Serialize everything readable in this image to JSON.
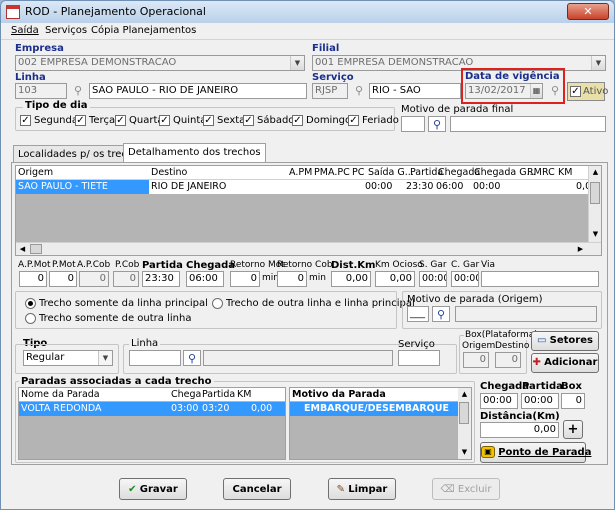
{
  "window": {
    "title": "ROD - Planejamento Operacional",
    "app_icon": "calendar-icon"
  },
  "menu": [
    "Saída",
    "Serviços",
    "Cópia Planejamentos"
  ],
  "empresa": {
    "label": "Empresa",
    "value": "002 EMPRESA DEMONSTRACAO"
  },
  "filial": {
    "label": "Filial",
    "value": "001 EMPRESA DEMONSTRACAO"
  },
  "linha": {
    "label": "Linha",
    "code": "103",
    "name": "SAO PAULO - RIO DE JANEIRO"
  },
  "servico": {
    "label": "Serviço",
    "code": "RJSP",
    "name": "RIO - SAO"
  },
  "vigencia": {
    "label": "Data de vigência",
    "value": "13/02/2017",
    "highlight": "#e0201c"
  },
  "ativo": {
    "label": "Ativo",
    "checked": true
  },
  "tipo_dia": {
    "label": "Tipo de dia",
    "days": [
      "Segunda",
      "Terça",
      "Quarta",
      "Quinta",
      "Sexta",
      "Sábado",
      "Domingo",
      "Feriado"
    ]
  },
  "motivo_final": {
    "label": "Motivo de parada final"
  },
  "tabs": [
    "Localidades p/ os trechos",
    "Detalhamento dos trechos"
  ],
  "grid": {
    "headers": [
      "Origem",
      "Destino",
      "A.PM",
      "PM",
      "A.PC",
      "PC",
      "Saída G...",
      "Partida",
      "Chegada",
      "Chegada G...",
      "RM",
      "RC",
      "KM"
    ],
    "rows": [
      {
        "origem": "SAO PAULO - TIETE",
        "destino": "RIO DE JANEIRO",
        "saida": "00:00",
        "partida": "23:30",
        "chegada": "06:00",
        "chegada_g": "00:00",
        "km": "0,0"
      }
    ]
  },
  "detail_labels": {
    "apmot": "A.P.Mot",
    "pmot": "P.Mot",
    "apcob": "A.P.Cob",
    "pcob": "P.Cob",
    "partida": "Partida",
    "chegada": "Chegada",
    "retmot": "Retorno Mot",
    "retcob": "Retorno Cob",
    "distkm": "Dist.Km",
    "kmocioso": "Km Ocioso",
    "sgar": "S. Gar",
    "cgar": "C. Gar",
    "via": "Via",
    "min": "min"
  },
  "detail_values": {
    "apmot": "0",
    "pmot": "0",
    "apcob": "0",
    "pcob": "0",
    "partida": "23:30",
    "chegada": "06:00",
    "retmot": "0",
    "retcob": "0",
    "distkm": "0,00",
    "kmocioso": "0,00",
    "sgar": "00:00",
    "cgar": "00:00",
    "via": ""
  },
  "radios": [
    "Trecho somente da linha principal",
    "Trecho somente de outra linha",
    "Trecho de outra linha e linha principal"
  ],
  "motivo_origem": {
    "label": "Motivo de parada (Origem)",
    "code": "___"
  },
  "tipo": {
    "label": "Tipo",
    "value": "Regular"
  },
  "linha2": {
    "label": "Linha"
  },
  "servico2": {
    "label": "Serviço"
  },
  "box": {
    "label": "Box(Plataforma)",
    "origem_label": "Origem",
    "destino_label": "Destino",
    "origem": "0",
    "destino": "0"
  },
  "setores_button": "Setores",
  "adicionar_button": "Adicionar",
  "paradas": {
    "title": "Paradas associadas a cada trecho",
    "headers": [
      "Nome da Parada",
      "Chega",
      "Partida",
      "KM"
    ],
    "rows": [
      {
        "nome": "VOLTA REDONDA",
        "chega": "03:00",
        "partida": "03:20",
        "km": "0,00"
      }
    ]
  },
  "motivo_list": {
    "title": "Motivo da Parada",
    "rows": [
      "EMBARQUE/DESEMBARQUE"
    ]
  },
  "stop_fields": {
    "chegada_label": "Chegada",
    "partida_label": "Partida",
    "box_label": "Box",
    "chegada": "00:00",
    "partida": "00:00",
    "box": "0",
    "dist_label": "Distância(Km)",
    "dist": "0,00"
  },
  "ponto_button": "Ponto de Parada",
  "footer": {
    "gravar": "Gravar",
    "cancelar": "Cancelar",
    "limpar": "Limpar",
    "excluir": "Excluir"
  },
  "colors": {
    "selection": "#3399ff",
    "navy": "#1a2f8c",
    "grid_bg": "#b4b4b4"
  }
}
